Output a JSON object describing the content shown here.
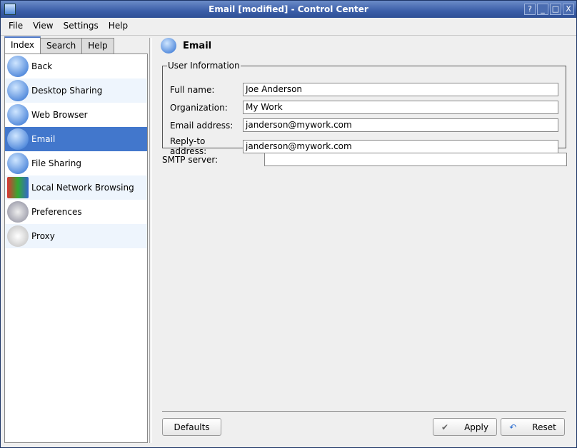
{
  "window": {
    "title": "Email [modified] - Control Center",
    "buttons": [
      "?",
      "_",
      "□",
      "X"
    ]
  },
  "menu": [
    "File",
    "View",
    "Settings",
    "Help"
  ],
  "tabs": [
    "Index",
    "Search",
    "Help"
  ],
  "sidebar": [
    {
      "label": "Back",
      "icon": "back-arrow-icon"
    },
    {
      "label": "Desktop Sharing",
      "icon": "desktop-sharing-icon"
    },
    {
      "label": "Web Browser",
      "icon": "web-browser-icon"
    },
    {
      "label": "Email",
      "icon": "email-icon",
      "selected": true
    },
    {
      "label": "File Sharing",
      "icon": "file-sharing-icon"
    },
    {
      "label": "Local Network Browsing",
      "icon": "network-browsing-icon"
    },
    {
      "label": "Preferences",
      "icon": "preferences-icon"
    },
    {
      "label": "Proxy",
      "icon": "proxy-icon"
    }
  ],
  "page": {
    "title": "Email",
    "group": "User Information",
    "fields": [
      {
        "label": "Full name:",
        "value": "Joe Anderson"
      },
      {
        "label": "Organization:",
        "value": "My Work"
      },
      {
        "label": "Email address:",
        "value": "janderson@mywork.com"
      },
      {
        "label": "Reply-to address:",
        "value": "janderson@mywork.com"
      }
    ],
    "smtp_label": "SMTP server:",
    "smtp_value": ""
  },
  "buttons": {
    "defaults": "Defaults",
    "apply": "Apply",
    "reset": "Reset"
  }
}
